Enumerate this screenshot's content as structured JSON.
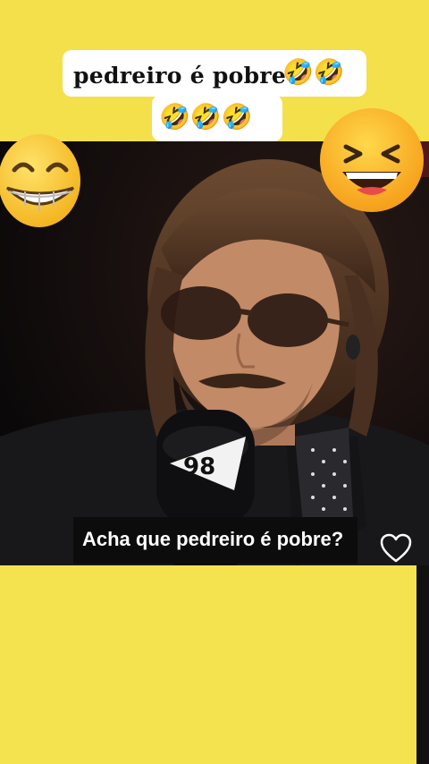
{
  "overlay": {
    "title": "pedreiro é pobre",
    "title_emojis": "🤣🤣",
    "title_emojis_line2": "🤣🤣🤣"
  },
  "video": {
    "caption": "Acha que pedreiro é pobre?",
    "mic_brand": "98"
  },
  "icons": {
    "left_emoji": "grinning-face-icon",
    "right_emoji": "laughing-face-icon",
    "like": "heart-icon"
  }
}
